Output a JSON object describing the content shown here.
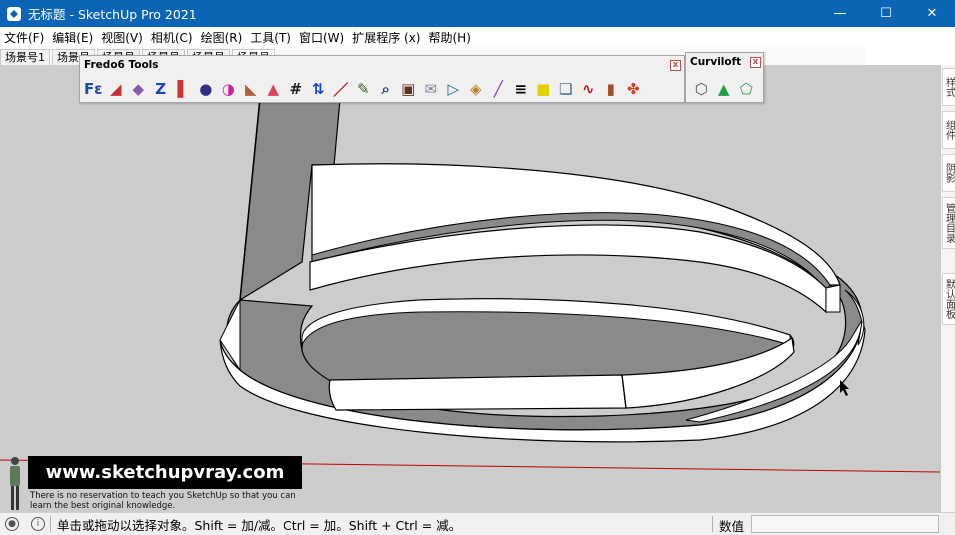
{
  "window": {
    "title": "无标题 - SketchUp Pro 2021",
    "minimize": "—",
    "maximize": "☐",
    "close": "✕"
  },
  "menu": [
    "文件(F)",
    "编辑(E)",
    "视图(V)",
    "相机(C)",
    "绘图(R)",
    "工具(T)",
    "窗口(W)",
    "扩展程序 (x)",
    "帮助(H)"
  ],
  "scenes": [
    "场景号1",
    "场景号",
    "场景号",
    "场景号",
    "场景号",
    "场景号"
  ],
  "toolbars": {
    "fredo": {
      "title": "Fredo6 Tools",
      "close": "x",
      "icons": [
        "fredo-scale-icon",
        "dimension-icon",
        "joint-push-pull-icon",
        "color-z-icon",
        "curvizard-icon",
        "thru-paint-icon",
        "color-wheel-icon",
        "round-corner-icon",
        "bookmark-icon",
        "tag-icon",
        "flip-icon",
        "line-icon",
        "pencil-icon",
        "zoom-icon",
        "box-icon",
        "envelope-icon",
        "triangle-icon",
        "diamond-icon",
        "slash-line-icon",
        "list-2-icon",
        "square-2-icon",
        "layers-icon",
        "wave-icon",
        "barrel-icon",
        "mixer-icon"
      ]
    },
    "curviloft": {
      "title": "Curviloft",
      "close": "x",
      "icons": [
        "loft-shield-icon",
        "skin-contour-icon",
        "loft-spline-icon"
      ]
    }
  },
  "right_tray": {
    "tabs": [
      "样式",
      "组件",
      "阴影",
      "管理目录",
      "默认面板"
    ]
  },
  "watermark": {
    "site": "www.sketchupvray.com",
    "tagline": "There is no reservation to teach you SketchUp so that you can learn the best original knowledge."
  },
  "status": {
    "hint": "单击或拖动以选择对象。Shift = 加/减。Ctrl = 加。Shift + Ctrl = 减。",
    "measurements_label": "数值",
    "measurements_value": ""
  },
  "colors": {
    "titlebar": "#0b64b4",
    "viewport_bg": "#cccccc",
    "face_white": "#ffffff",
    "face_gray": "#8a8a8a",
    "axis_red": "#c00000"
  }
}
